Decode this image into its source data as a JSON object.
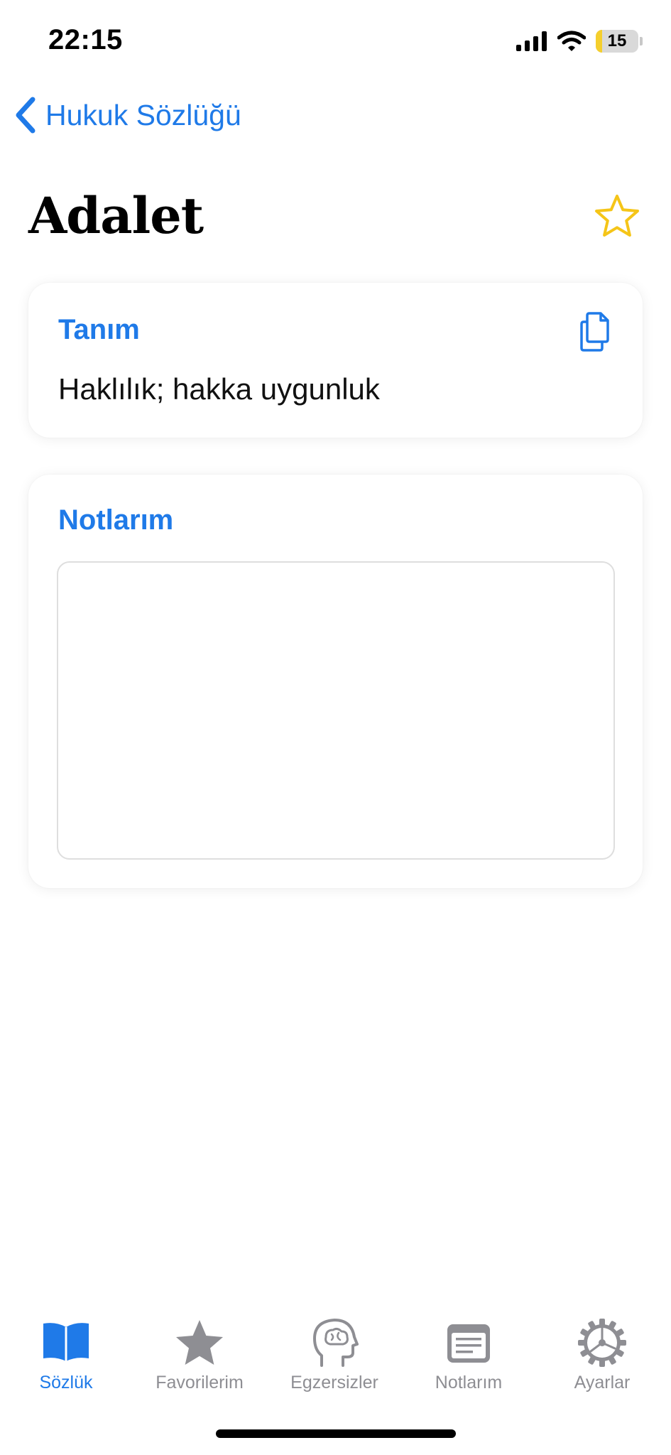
{
  "status_bar": {
    "time": "22:15",
    "battery_level": "15",
    "battery_fraction": 0.15,
    "icons": [
      "cellular-signal-icon",
      "wifi-icon",
      "battery-icon"
    ]
  },
  "nav": {
    "back_label": "Hukuk Sözlüğü",
    "back_icon": "chevron-left-icon"
  },
  "entry": {
    "title": "Adalet",
    "favorite_icon": "star-outline-icon",
    "favorited": false
  },
  "definition_card": {
    "heading": "Tanım",
    "text": "Haklılık; hakka uygunluk",
    "action_icon": "copy-icon"
  },
  "notes_card": {
    "heading": "Notlarım",
    "value": "",
    "placeholder": ""
  },
  "tab_bar": {
    "active": "Sözlük",
    "tabs": [
      {
        "label": "Sözlük",
        "icon": "book-icon"
      },
      {
        "label": "Favorilerim",
        "icon": "star-icon"
      },
      {
        "label": "Egzersizler",
        "icon": "brain-head-icon"
      },
      {
        "label": "Notlarım",
        "icon": "note-icon"
      },
      {
        "label": "Ayarlar",
        "icon": "gear-icon"
      }
    ]
  },
  "colors": {
    "accent": "#1f7ae8",
    "favorite": "#f5c518",
    "inactive": "#8e8e93",
    "battery_fill": "#f5cf2d"
  }
}
